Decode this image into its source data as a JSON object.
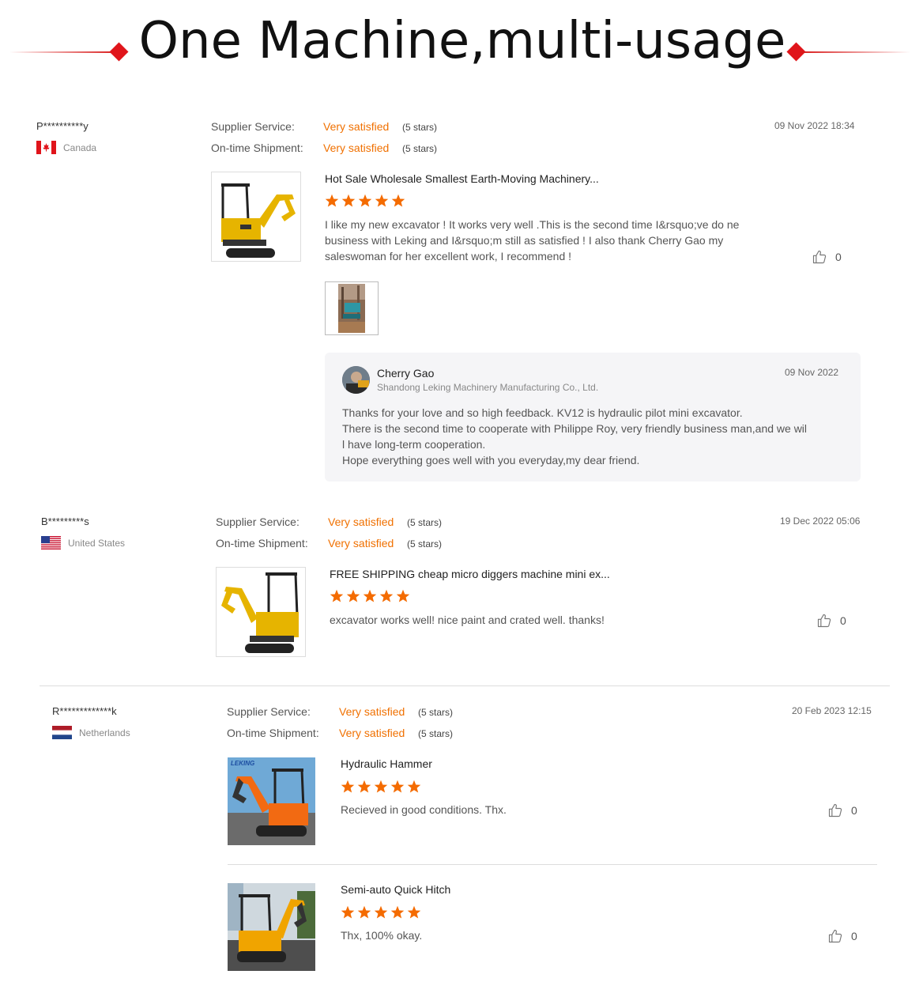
{
  "header": {
    "title": "One Machine,multi-usage"
  },
  "colors": {
    "accent": "#f07000",
    "header_red": "#e0151b"
  },
  "reviews": [
    {
      "user": "P**********y",
      "country": "Canada",
      "flag": "canada-flag",
      "supplier_label": "Supplier Service:",
      "supplier_value": "Very satisfied",
      "supplier_stars": "(5 stars)",
      "shipment_label": "On-time Shipment:",
      "shipment_value": "Very satisfied",
      "shipment_stars": "(5 stars)",
      "date": "09 Nov 2022 18:34",
      "products": [
        {
          "title": "Hot Sale Wholesale Smallest Earth-Moving Machinery...",
          "rating": 5,
          "comment": "I like my new excavator ! It works very well .This is the second time I&rsquo;ve do ne business with Leking and I&rsquo;m still as satisfied ! I also thank Cherry Gao my saleswoman for her excellent work, I recommend !",
          "likes": "0"
        }
      ],
      "reply": {
        "name": "Cherry Gao",
        "company": "Shandong Leking Machinery Manufacturing Co., Ltd.",
        "date": "09 Nov 2022",
        "text_lines": [
          "Thanks for your love and so high feedback. KV12 is hydraulic pilot mini excavator.",
          "There is the second time to cooperate with Philippe Roy, very friendly business man,and we wil",
          "l have long-term cooperation.",
          "Hope everything goes well with you everyday,my dear friend."
        ]
      }
    },
    {
      "user": "B*********s",
      "country": "United States",
      "flag": "usa-flag",
      "supplier_label": "Supplier Service:",
      "supplier_value": "Very satisfied",
      "supplier_stars": "(5 stars)",
      "shipment_label": "On-time Shipment:",
      "shipment_value": "Very satisfied",
      "shipment_stars": "(5 stars)",
      "date": "19 Dec 2022 05:06",
      "products": [
        {
          "title": "FREE SHIPPING cheap micro diggers machine mini ex...",
          "rating": 5,
          "comment": "excavator works well! nice paint and crated well. thanks!",
          "likes": "0"
        }
      ]
    },
    {
      "user": "R*************k",
      "country": "Netherlands",
      "flag": "netherlands-flag",
      "supplier_label": "Supplier Service:",
      "supplier_value": "Very satisfied",
      "supplier_stars": "(5 stars)",
      "shipment_label": "On-time Shipment:",
      "shipment_value": "Very satisfied",
      "shipment_stars": "(5 stars)",
      "date": "20 Feb 2023 12:15",
      "products": [
        {
          "title": "Hydraulic Hammer",
          "rating": 5,
          "comment": "Recieved in good conditions. Thx.",
          "likes": "0",
          "image_logo_text": "LEKING"
        },
        {
          "title": "Semi-auto Quick Hitch",
          "rating": 5,
          "comment": "Thx, 100% okay.",
          "likes": "0"
        }
      ]
    }
  ]
}
